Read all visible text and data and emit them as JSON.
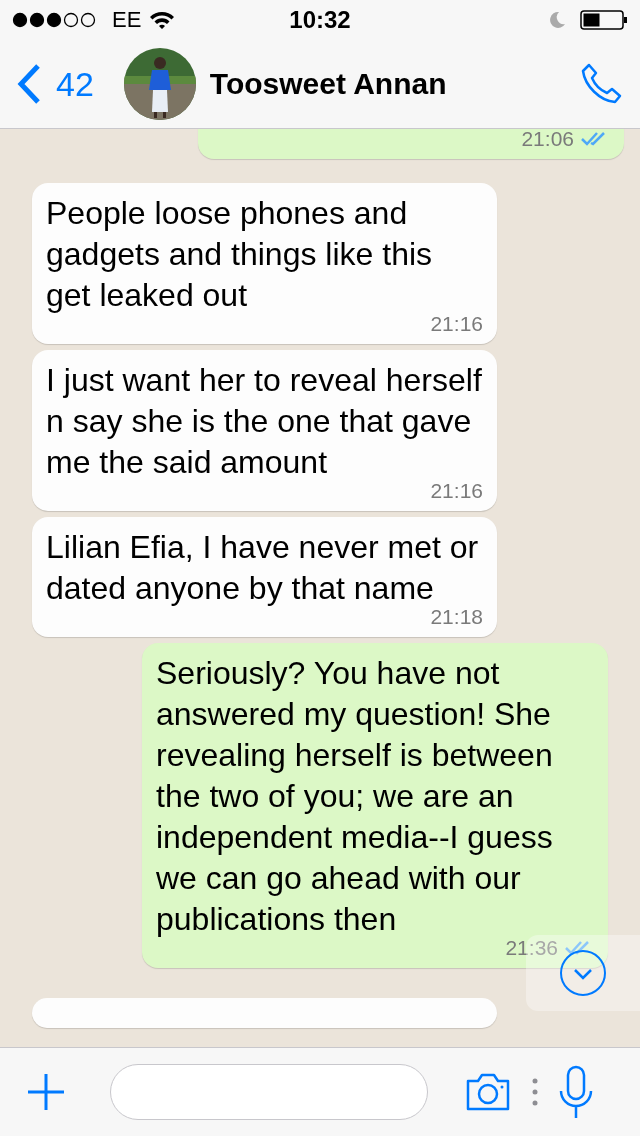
{
  "status_bar": {
    "carrier": "EE",
    "time": "10:32"
  },
  "header": {
    "back_count": "42",
    "contact_name": "Toosweet Annan"
  },
  "messages": [
    {
      "outgoing": true,
      "time": "21:06",
      "read": true
    },
    {
      "outgoing": false,
      "text": "People loose phones and gadgets and things like this get leaked out",
      "time": "21:16"
    },
    {
      "outgoing": false,
      "text": "I just want her to reveal herself n say she is the one that gave me the said amount",
      "time": "21:16"
    },
    {
      "outgoing": false,
      "text": "Lilian Efia, I have never met or dated anyone by that name",
      "time": "21:18"
    },
    {
      "outgoing": true,
      "text": "Seriously? You have not answered my question! She revealing herself is between the two of you; we are an independent media--I guess we can go ahead with our publications then",
      "time": "21:36",
      "read": true
    },
    {
      "outgoing": false
    }
  ]
}
